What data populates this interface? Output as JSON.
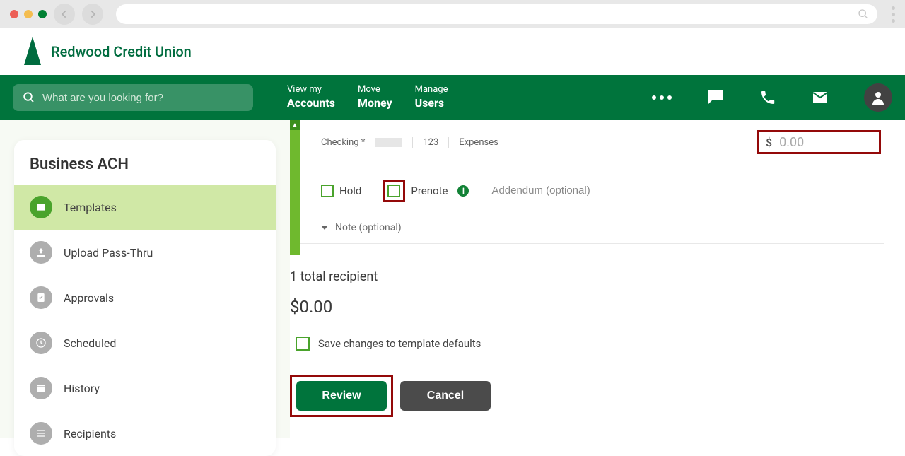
{
  "brand": "Redwood Credit Union",
  "search_placeholder": "What are you looking for?",
  "nav": {
    "accounts_top": "View my",
    "accounts_bot": "Accounts",
    "money_top": "Move",
    "money_bot": "Money",
    "users_top": "Manage",
    "users_bot": "Users"
  },
  "sidebar": {
    "title": "Business ACH",
    "items": [
      {
        "label": "Templates"
      },
      {
        "label": "Upload Pass-Thru"
      },
      {
        "label": "Approvals"
      },
      {
        "label": "Scheduled"
      },
      {
        "label": "History"
      },
      {
        "label": "Recipients"
      }
    ]
  },
  "recipient": {
    "account_type": "Checking *",
    "id": "123",
    "category": "Expenses",
    "amount_placeholder": "0.00",
    "hold_label": "Hold",
    "prenote_label": "Prenote",
    "addendum_placeholder": "Addendum (optional)",
    "note_label": "Note (optional)"
  },
  "summary": {
    "recipients_line": "1 total recipient",
    "total": "$0.00",
    "save_changes_label": "Save changes to template defaults",
    "review_label": "Review",
    "cancel_label": "Cancel"
  }
}
